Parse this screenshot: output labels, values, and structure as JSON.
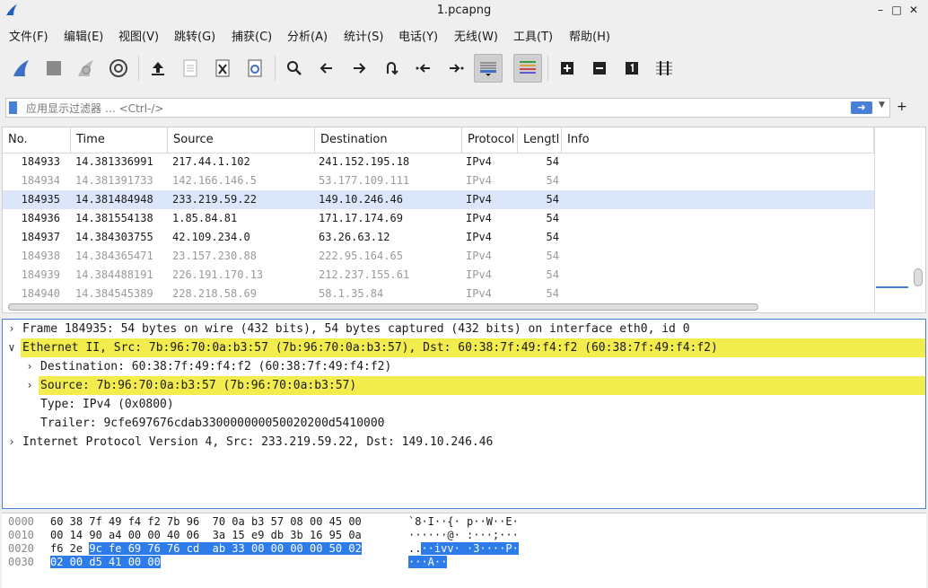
{
  "window": {
    "title": "1.pcapng"
  },
  "menu": [
    "文件(F)",
    "编辑(E)",
    "视图(V)",
    "跳转(G)",
    "捕获(C)",
    "分析(A)",
    "统计(S)",
    "电话(Y)",
    "无线(W)",
    "工具(T)",
    "帮助(H)"
  ],
  "filter": {
    "placeholder": "应用显示过滤器 … <Ctrl-/>",
    "value": ""
  },
  "packet_list": {
    "columns": [
      "No.",
      "Time",
      "Source",
      "Destination",
      "Protocol",
      "Lengtl",
      "Info"
    ],
    "rows": [
      {
        "no": "184933",
        "time": "14.381336991",
        "src": "217.44.1.102",
        "dst": "241.152.195.18",
        "proto": "IPv4",
        "len": "54",
        "style": "normal"
      },
      {
        "no": "184934",
        "time": "14.381391733",
        "src": "142.166.146.5",
        "dst": "53.177.109.111",
        "proto": "IPv4",
        "len": "54",
        "style": "grey"
      },
      {
        "no": "184935",
        "time": "14.381484948",
        "src": "233.219.59.22",
        "dst": "149.10.246.46",
        "proto": "IPv4",
        "len": "54",
        "style": "selected"
      },
      {
        "no": "184936",
        "time": "14.381554138",
        "src": "1.85.84.81",
        "dst": "171.17.174.69",
        "proto": "IPv4",
        "len": "54",
        "style": "normal"
      },
      {
        "no": "184937",
        "time": "14.384303755",
        "src": "42.109.234.0",
        "dst": "63.26.63.12",
        "proto": "IPv4",
        "len": "54",
        "style": "normal"
      },
      {
        "no": "184938",
        "time": "14.384365471",
        "src": "23.157.230.88",
        "dst": "222.95.164.65",
        "proto": "IPv4",
        "len": "54",
        "style": "grey"
      },
      {
        "no": "184939",
        "time": "14.384488191",
        "src": "226.191.170.13",
        "dst": "212.237.155.61",
        "proto": "IPv4",
        "len": "54",
        "style": "grey"
      },
      {
        "no": "184940",
        "time": "14.384545389",
        "src": "228.218.58.69",
        "dst": "58.1.35.84",
        "proto": "IPv4",
        "len": "54",
        "style": "grey"
      }
    ]
  },
  "details": [
    {
      "text": "Frame 184935: 54 bytes on wire (432 bits), 54 bytes captured (432 bits) on interface eth0, id 0",
      "level": 0,
      "arrow": "collapsed",
      "highlight": false
    },
    {
      "text": "Ethernet II, Src: 7b:96:70:0a:b3:57 (7b:96:70:0a:b3:57), Dst: 60:38:7f:49:f4:f2 (60:38:7f:49:f4:f2)",
      "level": 0,
      "arrow": "expanded",
      "highlight": true
    },
    {
      "text": "Destination: 60:38:7f:49:f4:f2 (60:38:7f:49:f4:f2)",
      "level": 1,
      "arrow": "collapsed",
      "highlight": false
    },
    {
      "text": "Source: 7b:96:70:0a:b3:57 (7b:96:70:0a:b3:57)",
      "level": 1,
      "arrow": "collapsed",
      "highlight": true
    },
    {
      "text": "Type: IPv4 (0x0800)",
      "level": 1,
      "arrow": "none",
      "highlight": false
    },
    {
      "text": "Trailer: 9cfe697676cdab330000000050020200d5410000",
      "level": 1,
      "arrow": "none",
      "highlight": false
    },
    {
      "text": "Internet Protocol Version 4, Src: 233.219.59.22, Dst: 149.10.246.46",
      "level": 0,
      "arrow": "collapsed",
      "highlight": false
    }
  ],
  "bytes": [
    {
      "offset": "0000",
      "hex_plain": "60 38 7f 49 f4 f2 7b 96  70 0a b3 57 08 00 45 00",
      "hex_sel": "",
      "ascii_plain": "`8·I··{· p··W··E·",
      "ascii_sel": ""
    },
    {
      "offset": "0010",
      "hex_plain": "00 14 90 a4 00 00 40 06  3a 15 e9 db 3b 16 95 0a",
      "hex_sel": "",
      "ascii_plain": "······@· :···;···",
      "ascii_sel": ""
    },
    {
      "offset": "0020",
      "hex_plain": "f6 2e ",
      "hex_sel": "9c fe 69 76 76 cd  ab 33 00 00 00 00 50 02",
      "ascii_plain": "..",
      "ascii_sel": "··ivv· ·3····P·"
    },
    {
      "offset": "0030",
      "hex_plain": "",
      "hex_sel": "02 00 d5 41 00 00",
      "ascii_plain": "",
      "ascii_sel": "···A··"
    }
  ],
  "colors": {
    "selection_row": "#dbe6fb",
    "highlight_yellow": "#f2ec4c",
    "byte_selection": "#2e7bea",
    "accent": "#4a7fd6"
  }
}
